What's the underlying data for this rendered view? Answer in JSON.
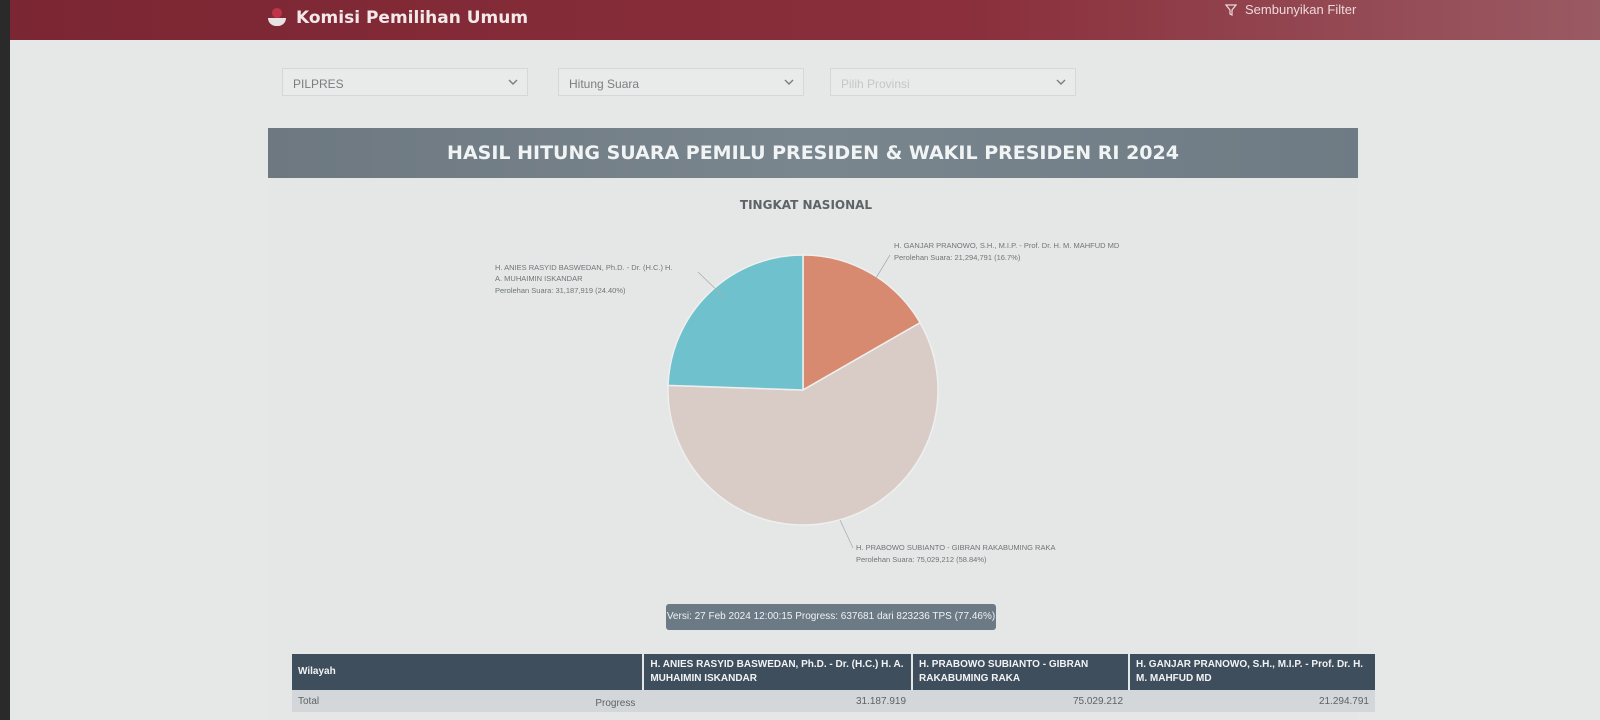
{
  "header": {
    "brand": "Komisi Pemilihan Umum",
    "filter_toggle": "Sembunyikan Filter"
  },
  "filters": {
    "election_type": "PILPRES",
    "count_type": "Hitung Suara",
    "province_placeholder": "Pilih Provinsi"
  },
  "panel": {
    "title": "HASIL HITUNG SUARA PEMILU PRESIDEN & WAKIL PRESIDEN RI 2024"
  },
  "chart_data": {
    "type": "pie",
    "title": "TINGKAT NASIONAL",
    "slices": [
      {
        "name": "H. ANIES RASYID BASWEDAN, Ph.D. - Dr. (H.C.) H. A. MUHAIMIN ISKANDAR",
        "value": 31187919,
        "label": "Perolehan Suara: 31,187,919 (24.40%)",
        "color": "#6fc1cd"
      },
      {
        "name": "H. PRABOWO SUBIANTO - GIBRAN RAKABUMING RAKA",
        "value": 75029212,
        "label": "Perolehan Suara: 75,029,212 (58.84%)",
        "color": "#d9ccc6"
      },
      {
        "name": "H. GANJAR PRANOWO, S.H., M.I.P. - Prof. Dr. H. M. MAHFUD MD",
        "value": 21294791,
        "label": "Perolehan Suara: 21,294,791 (16.7%)",
        "color": "#d88a70"
      }
    ],
    "legend": "none"
  },
  "version": "Versi: 27 Feb 2024 12:00:15 Progress: 637681 dari 823236 TPS (77.46%)",
  "table": {
    "headers": [
      "Wilayah",
      "H. ANIES RASYID BASWEDAN, Ph.D. - Dr. (H.C.) H. A. MUHAIMIN ISKANDAR",
      "H. PRABOWO SUBIANTO - GIBRAN RAKABUMING RAKA",
      "H. GANJAR PRANOWO, S.H., M.I.P. - Prof. Dr. H. M. MAHFUD MD"
    ],
    "total_row": {
      "label": "Total",
      "progress_label": "Progress",
      "anies": "31.187.919",
      "prabowo": "75.029.212",
      "ganjar": "21.294.791"
    }
  }
}
